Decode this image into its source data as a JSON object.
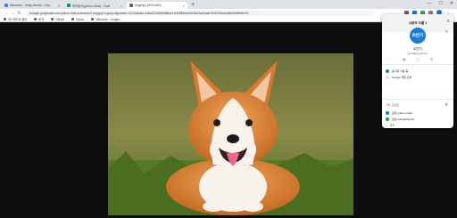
{
  "tabs": [
    {
      "label": "Welcome - zeeg-vendor - Goo",
      "favicon_color": "#4285f4",
      "active": false
    },
    {
      "label": "외부링크(yahoo Chat) - Chat",
      "favicon_color": "#0f9d58",
      "active": false
    },
    {
      "label": "dogpng (1024×682)",
      "favicon_color": "#5f6368",
      "active": true
    },
    {
      "label": "",
      "favicon_color": "",
      "active": false
    }
  ],
  "new_tab": "+",
  "window_controls": {
    "minimize": "—",
    "maximize": "☐",
    "close": "✕"
  },
  "url": "storage.googleapis.com/yahoo-chat-extension/1.dog.jpg?x-goog-signature=121346c8cc1cd0a91c2d0f8d8bac12cf09844a2ef13fa23cebaae7548763d4ec8b6699fd5b47b...",
  "bookmarks": [
    "대시보드로 돌아",
    "문의",
    "GitHub",
    "Notion",
    "Welcome - Google..."
  ],
  "profile_panel": {
    "title": "사용자 이름 1",
    "close_icon": "✕",
    "avatar_text": "로빈기",
    "name": "로빈기",
    "email": "guest@gmail.com",
    "tools": [
      "⇆",
      "⬚",
      "⚲"
    ],
    "sync_text": "동기화 사용 중",
    "google_account_text": "Google 계정 관리",
    "other_profiles_label": "기타 프로필",
    "profiles": [
      {
        "label": "로빈 (yahoo.chat)",
        "color": "#1a73e8"
      },
      {
        "label": "로빈 (singularity.ai)",
        "color": "#0f9d58"
      }
    ],
    "add_label": "추가",
    "colors": {
      "header_bg": "#f1f3f4",
      "avatar_bg": "#1e7bd8",
      "sync_dot": "#1e8e3e"
    }
  }
}
